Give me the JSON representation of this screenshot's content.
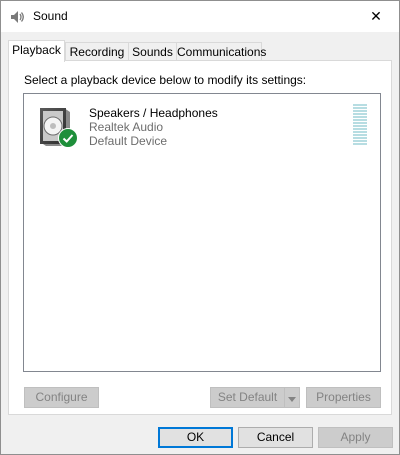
{
  "window": {
    "title": "Sound",
    "close_symbol": "✕"
  },
  "tabs": [
    {
      "label": "Playback",
      "active": true
    },
    {
      "label": "Recording",
      "active": false
    },
    {
      "label": "Sounds",
      "active": false
    },
    {
      "label": "Communications",
      "active": false
    }
  ],
  "playback": {
    "instructions": "Select a playback device below to modify its settings:",
    "devices": [
      {
        "name": "Speakers / Headphones",
        "driver": "Realtek Audio",
        "status": "Default Device",
        "icon": "speaker-icon",
        "badge": "default-check-icon"
      }
    ],
    "buttons": {
      "configure": "Configure",
      "set_default": "Set Default",
      "properties": "Properties"
    }
  },
  "footer": {
    "ok": "OK",
    "cancel": "Cancel",
    "apply": "Apply"
  },
  "colors": {
    "accent": "#0078d7",
    "check_badge": "#1e8f3a",
    "level_meter": "#b7dde2"
  }
}
